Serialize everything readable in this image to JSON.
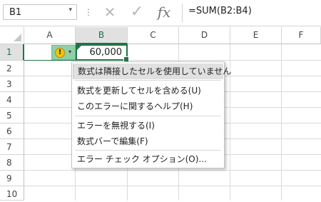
{
  "formula_bar": {
    "name_box": "B1",
    "name_box_arrow": "▾",
    "separator_glyph": "⋮",
    "cancel_glyph": "✕",
    "enter_glyph": "✓",
    "insert_function_glyph": "fx",
    "formula": "=SUM(B2:B4)"
  },
  "grid": {
    "columns": [
      "A",
      "B",
      "C",
      "D",
      "E",
      "F"
    ],
    "selected_column": "B",
    "rows": [
      "1",
      "2",
      "3",
      "4",
      "5",
      "6",
      "7",
      "8",
      "9",
      "10"
    ],
    "selected_row": "1",
    "active_cell_value": "60,000"
  },
  "smart_tag": {
    "warning_glyph": "!",
    "dropdown_glyph": "▾"
  },
  "context_menu": {
    "items": [
      "数式は隣接したセルを使用していません",
      "数式を更新してセルを含める(U)",
      "このエラーに関するヘルプ(H)",
      "エラーを無視する(I)",
      "数式バーで編集(F)",
      "エラー チェック オプション(O)..."
    ]
  },
  "colors": {
    "accent": "#217346",
    "smart_tag_bg": "#8fd0a8",
    "warning": "#f4c20d"
  }
}
